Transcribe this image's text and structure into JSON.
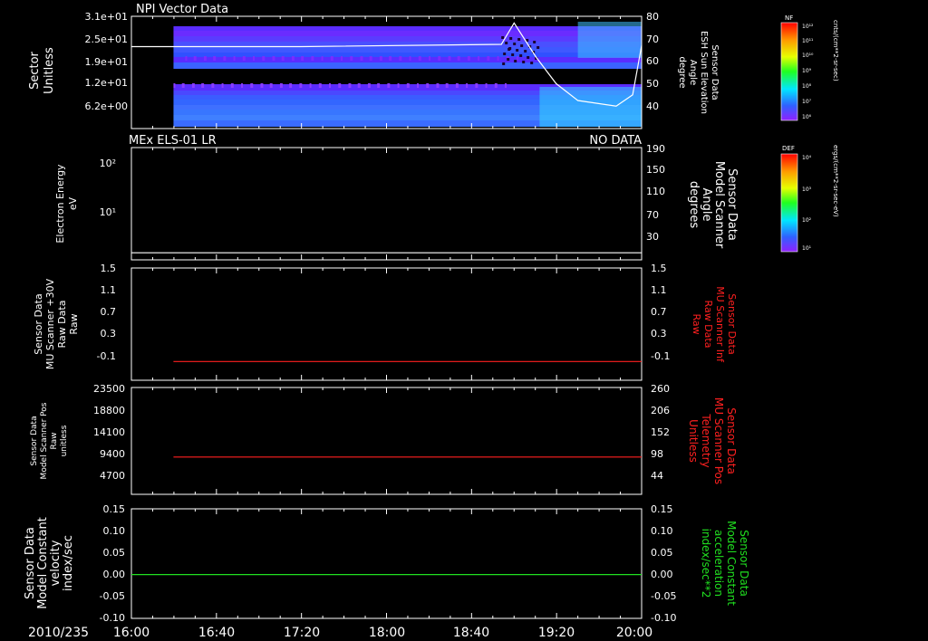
{
  "date_label": "2010/235",
  "time_ticks": [
    "16:00",
    "16:40",
    "17:20",
    "18:00",
    "18:40",
    "19:20",
    "20:00"
  ],
  "chart_data": [
    {
      "type": "heatmap",
      "title": "NPI Vector Data",
      "ylabel": [
        "Sector",
        "Unitless"
      ],
      "yticks": [
        "3.1e+01",
        "2.5e+01",
        "1.9e+01",
        "1.2e+01",
        "6.2e+00"
      ],
      "ylim": [
        0,
        32
      ],
      "right_axis": {
        "label": [
          "Sensor Data",
          "ESH Sun Elevation",
          "Angle",
          "degree"
        ],
        "ticks": [
          "80",
          "70",
          "60",
          "50",
          "40"
        ],
        "ylim": [
          30,
          80
        ]
      },
      "line_series": {
        "name": "ESH Sun Elevation Angle",
        "color": "#ffffff",
        "x_hours": [
          16.0,
          17.33,
          18.9,
          19.0,
          19.17,
          19.33,
          19.5,
          19.8,
          19.93,
          20.0
        ],
        "y": [
          66.5,
          66.5,
          67.5,
          77,
          62,
          50,
          42.5,
          40,
          45,
          67
        ]
      },
      "colorbar": {
        "label": "NF",
        "units": "cnts/(cm**2-sr-sec)",
        "ticks": [
          "10¹²",
          "10¹¹",
          "10¹⁰",
          "10⁹",
          "10⁸",
          "10⁷",
          "10⁶"
        ]
      }
    },
    {
      "type": "heatmap",
      "title": "MEx ELS-01 LR",
      "status": "NO DATA",
      "ylabel": [
        "Electron Energy",
        "eV"
      ],
      "yticks": [
        "10²",
        "10¹"
      ],
      "right_axis": {
        "label": [
          "Sensor Data",
          "Model Scanner",
          "Angle",
          "degrees"
        ],
        "ticks": [
          "190",
          "150",
          "110",
          "70",
          "30"
        ],
        "ylim": [
          0,
          190
        ]
      },
      "line_series": {
        "name": "Model Scanner Angle",
        "color": "#ffffff",
        "x_hours": [
          16.0,
          20.0
        ],
        "y": [
          12,
          12
        ]
      },
      "colorbar": {
        "label": "DEF",
        "units": "ergs/(cm**2-sr-sec-eV)",
        "ticks": [
          "10⁴",
          "10³",
          "10²",
          "10¹"
        ]
      }
    },
    {
      "type": "line",
      "ylabel": [
        "Sensor Data",
        "MU Scanner +30V",
        "Raw Data",
        "Raw"
      ],
      "yticks": [
        "1.5",
        "1.1",
        "0.7",
        "0.3",
        "-0.1"
      ],
      "ylim": [
        -0.3,
        1.5
      ],
      "right_axis": {
        "label": [
          "Sensor Data",
          "MU Scanner Inf",
          "Raw Data",
          "Raw"
        ],
        "label_color": "#ff2020",
        "ticks": [
          "1.5",
          "1.1",
          "0.7",
          "0.3",
          "-0.1"
        ],
        "ylim": [
          -0.3,
          1.5
        ]
      },
      "series": [
        {
          "color": "#ff2020",
          "x_hours": [
            16.33,
            20.0
          ],
          "y": [
            0.0,
            0.0
          ]
        }
      ]
    },
    {
      "type": "line",
      "ylabel": [
        "Sensor Data",
        "Model Scanner Pos",
        "Raw",
        "unitless"
      ],
      "yticks": [
        "23500",
        "18800",
        "14100",
        "9400",
        "4700"
      ],
      "ylim": [
        0,
        23500
      ],
      "right_axis": {
        "label": [
          "Sensor Data",
          "MU Scanner Pos",
          "Telemetry",
          "Unitless"
        ],
        "label_color": "#ff2020",
        "ticks": [
          "260",
          "206",
          "152",
          "98",
          "44"
        ],
        "ylim": [
          0,
          260
        ]
      },
      "series": [
        {
          "color": "#ff2020",
          "x_hours": [
            16.33,
            20.0
          ],
          "y": [
            8200,
            8200
          ]
        }
      ]
    },
    {
      "type": "line",
      "ylabel": [
        "Sensor Data",
        "Model Constant",
        "velocity",
        "index/sec"
      ],
      "yticks": [
        "0.15",
        "0.10",
        "0.05",
        "0.00",
        "-0.05",
        "-0.10"
      ],
      "ylim": [
        -0.1,
        0.15
      ],
      "right_axis": {
        "label": [
          "Sensor Data",
          "Model Constant",
          "acceleration",
          "index/sec**2"
        ],
        "label_color": "#20e020",
        "ticks": [
          "0.15",
          "0.10",
          "0.05",
          "0.00",
          "-0.05",
          "-0.10"
        ],
        "ylim": [
          -0.1,
          0.15
        ]
      },
      "series": [
        {
          "color": "#20e020",
          "x_hours": [
            16.0,
            20.0
          ],
          "y": [
            0.0,
            0.0
          ]
        }
      ]
    }
  ]
}
